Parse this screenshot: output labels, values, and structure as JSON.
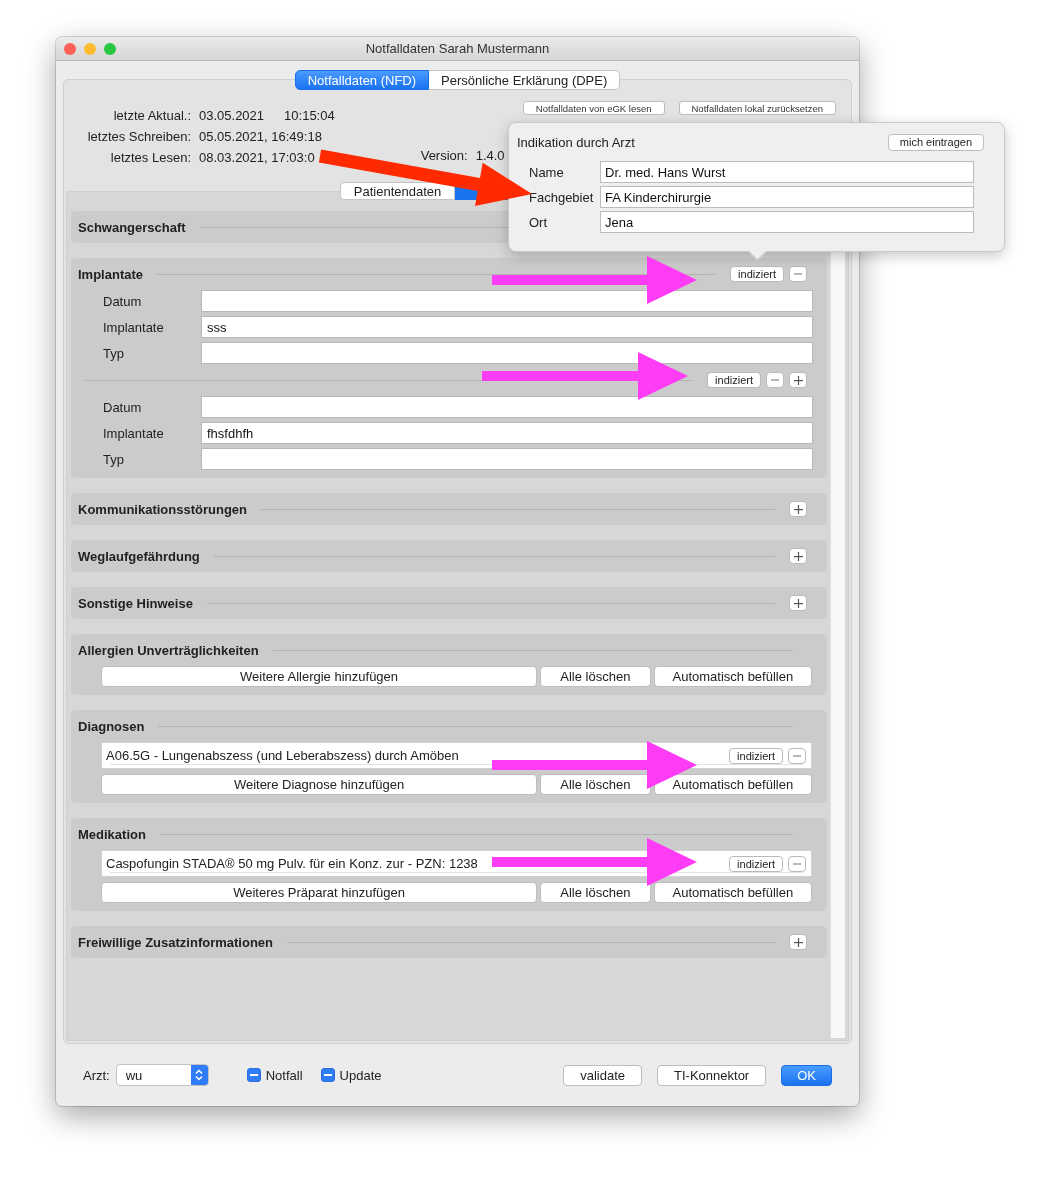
{
  "window": {
    "title": "Notfalldaten Sarah Mustermann"
  },
  "tabs": [
    {
      "label": "Notfalldaten (NFD)",
      "selected": true
    },
    {
      "label": "Persönliche Erklärung (DPE)",
      "selected": false
    }
  ],
  "info": [
    {
      "label": "letzte Aktual.:",
      "values": [
        "03.05.2021",
        "10:15:04"
      ]
    },
    {
      "label": "letztes Schreiben:",
      "values": [
        "05.05.2021, 16:49:18"
      ]
    },
    {
      "label": "letztes Lesen:",
      "values": [
        "08.03.2021, 17:03:0"
      ]
    }
  ],
  "header_buttons": [
    "Notfalldaten von eGK lesen",
    "Notfalldaten lokal zurücksetzen"
  ],
  "version": {
    "label": "Version:",
    "value": "1.4.0"
  },
  "view_switch": [
    {
      "label": "Patientendaten",
      "selected": false
    },
    {
      "selected": true
    }
  ],
  "sections": [
    {
      "kind": "header",
      "title": "Schwangerschaft"
    },
    {
      "kind": "entries",
      "title": "Implantate",
      "controls": [
        {
          "kind": "indicate",
          "label": "indiziert"
        },
        {
          "kind": "remove"
        }
      ],
      "entries": [
        {
          "fields": [
            {
              "label": "Datum"
            },
            {
              "label": "Implantate",
              "value": "sss"
            },
            {
              "label": "Typ"
            }
          ]
        },
        {
          "controls": [
            {
              "kind": "indicate",
              "label": "indiziert"
            },
            {
              "kind": "remove"
            },
            {
              "kind": "add"
            }
          ],
          "fields": [
            {
              "label": "Datum"
            },
            {
              "label": "Implantate",
              "value": "fhsfdhfh"
            },
            {
              "label": "Typ"
            }
          ]
        }
      ]
    },
    {
      "kind": "header",
      "title": "Kommunikationsstörungen",
      "controls": [
        {
          "kind": "add"
        }
      ]
    },
    {
      "kind": "header",
      "title": "Weglaufgefährdung",
      "controls": [
        {
          "kind": "add"
        }
      ]
    },
    {
      "kind": "header",
      "title": "Sonstige Hinweise",
      "controls": [
        {
          "kind": "add"
        }
      ]
    },
    {
      "kind": "list",
      "title": "Allergien Unverträglichkeiten",
      "buttons": [
        "Weitere Allergie hinzufügen",
        "Alle löschen",
        "Automatisch befüllen"
      ]
    },
    {
      "kind": "list",
      "title": "Diagnosen",
      "items": [
        {
          "text": "A06.5G  -  Lungenabszess (und Leberabszess) durch Amöben",
          "controls": [
            {
              "kind": "indicate",
              "label": "indiziert"
            },
            {
              "kind": "remove"
            }
          ]
        }
      ],
      "buttons": [
        "Weitere Diagnose hinzufügen",
        "Alle löschen",
        "Automatisch befüllen"
      ]
    },
    {
      "kind": "list",
      "title": "Medikation",
      "items": [
        {
          "text": "Caspofungin STADA® 50 mg Pulv. für ein Konz. zur  -  PZN: 1238",
          "controls": [
            {
              "kind": "indicate",
              "label": "indiziert"
            },
            {
              "kind": "remove"
            }
          ]
        }
      ],
      "buttons": [
        "Weiteres Präparat hinzufügen",
        "Alle löschen",
        "Automatisch befüllen"
      ]
    },
    {
      "kind": "header",
      "title": "Freiwillige Zusatzinformationen",
      "controls": [
        {
          "kind": "add"
        }
      ]
    }
  ],
  "popover": {
    "title": "Indikation durch Arzt",
    "button": "mich eintragen",
    "fields": [
      {
        "label": "Name",
        "value": "Dr. med. Hans Wurst"
      },
      {
        "label": "Fachgebiet",
        "value": "FA Kinderchirurgie"
      },
      {
        "label": "Ort",
        "value": "Jena"
      }
    ]
  },
  "footer": {
    "doctor_label": "Arzt:",
    "doctor_value": "wu",
    "checkboxes": [
      {
        "label": "Notfall",
        "mixed": true
      },
      {
        "label": "Update",
        "mixed": true
      }
    ],
    "buttons": [
      {
        "label": "validate",
        "default": false
      },
      {
        "label": "TI-Konnektor",
        "default": false
      },
      {
        "label": "OK",
        "default": true
      }
    ]
  },
  "annotation_arrows": [
    {
      "color": "#ff2a00"
    },
    {
      "color": "#ff3cf5"
    },
    {
      "color": "#ff3cf5"
    },
    {
      "color": "#ff3cf5"
    },
    {
      "color": "#ff3cf5"
    }
  ]
}
